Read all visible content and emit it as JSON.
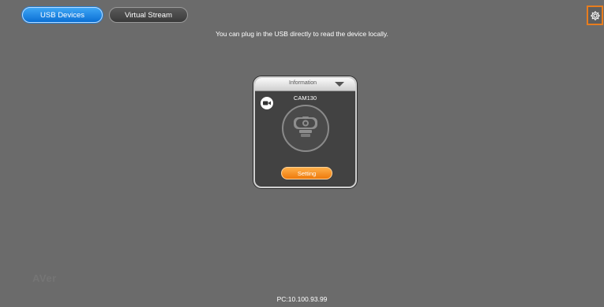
{
  "tabs": [
    {
      "label": "USB Devices",
      "active": true
    },
    {
      "label": "Virtual Stream",
      "active": false
    }
  ],
  "settings_icon": "gear-icon",
  "hint_text": "You can plug in the USB directly to read the device locally.",
  "device_card": {
    "header_label": "Information",
    "device_name": "CAM130",
    "device_type_icon": "video-camera-icon",
    "device_image_icon": "webcam-icon",
    "setting_label": "Setting"
  },
  "watermark": "AVer",
  "footer": {
    "ip_text": "PC:10.100.93.99"
  },
  "colors": {
    "background": "#6b6b6b",
    "tab_active": "#0b6fd4",
    "accent_orange": "#ee7a0c"
  }
}
